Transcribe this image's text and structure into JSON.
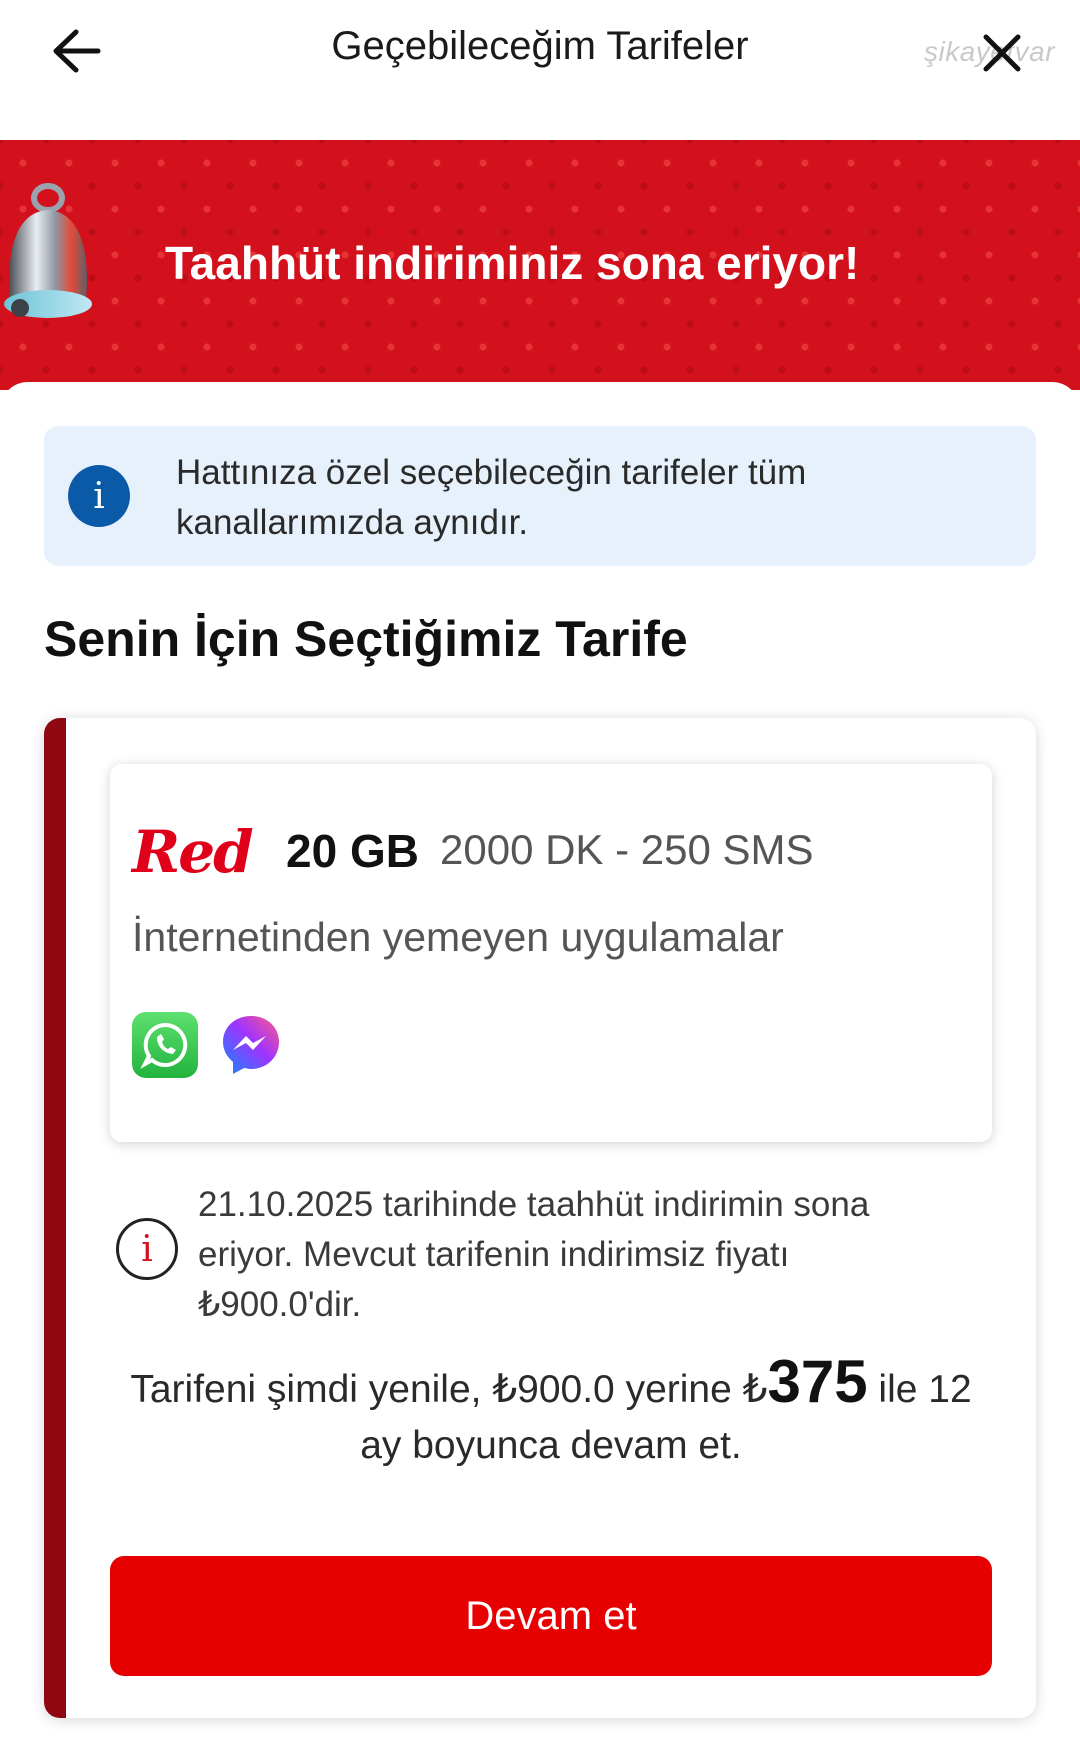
{
  "header": {
    "title": "Geçebileceğim Tarifeler",
    "watermark": "şikayetvar"
  },
  "banner": {
    "title": "Taahhüt indiriminiz sona eriyor!"
  },
  "info": {
    "text": "Hattınıza özel seçebileceğin tarifeler tüm kanallarımızda aynıdır."
  },
  "section": {
    "title": "Senin İçin Seçtiğimiz Tarife"
  },
  "tariff": {
    "brand": "Red",
    "data": "20 GB",
    "extras": "2000 DK - 250 SMS",
    "description": "İnternetinden yemeyen uygulamalar",
    "apps": [
      "whatsapp-icon",
      "messenger-icon"
    ],
    "warning": "21.10.2025 tarihinde taahhüt indirimin sona eriyor. Mevcut tarifenin indirimsiz fiyatı ₺900.0'dir.",
    "offer_before": "Tarifeni şimdi yenile, ₺900.0 yerine ₺",
    "offer_price": "375",
    "offer_after": " ile 12 ay boyunca devam et.",
    "button_label": "Devam et"
  },
  "colors": {
    "brand_red": "#e60000",
    "banner_red": "#d3111c",
    "accent_bar": "#8f0811",
    "info_bg": "#e6f1fb",
    "info_icon": "#0a5aa8"
  }
}
